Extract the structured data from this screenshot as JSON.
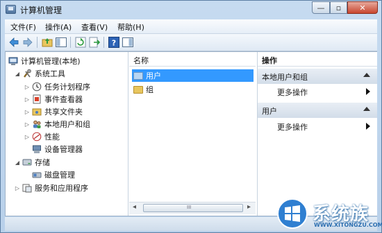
{
  "window": {
    "title": "计算机管理",
    "min_glyph": "—",
    "max_glyph": "▫",
    "close_glyph": "✕"
  },
  "menu": [
    "文件(F)",
    "操作(A)",
    "查看(V)",
    "帮助(H)"
  ],
  "toolbar_icons": [
    "back-arrow-icon",
    "forward-arrow-icon",
    "up-folder-icon",
    "show-hide-tree-icon",
    "refresh-icon",
    "export-list-icon",
    "help-icon",
    "show-hide-action-pane-icon"
  ],
  "tree": {
    "root": "计算机管理(本地)",
    "items": [
      {
        "label": "系统工具",
        "icon": "tools-icon",
        "expander": "◢"
      },
      {
        "label": "任务计划程序",
        "icon": "clock-icon",
        "expander": "▷"
      },
      {
        "label": "事件查看器",
        "icon": "event-viewer-icon",
        "expander": "▷"
      },
      {
        "label": "共享文件夹",
        "icon": "shared-folder-icon",
        "expander": "▷"
      },
      {
        "label": "本地用户和组",
        "icon": "users-icon",
        "expander": "▷"
      },
      {
        "label": "性能",
        "icon": "performance-icon",
        "expander": "▷"
      },
      {
        "label": "设备管理器",
        "icon": "device-manager-icon",
        "expander": ""
      },
      {
        "label": "存储",
        "icon": "storage-icon",
        "expander": "◢"
      },
      {
        "label": "磁盘管理",
        "icon": "disk-icon",
        "expander": ""
      },
      {
        "label": "服务和应用程序",
        "icon": "services-icon",
        "expander": "▷"
      }
    ]
  },
  "list": {
    "header": "名称",
    "rows": [
      {
        "label": "用户",
        "selected": true
      },
      {
        "label": "组",
        "selected": false
      }
    ],
    "scroll_glyph_left": "◂",
    "scroll_glyph_right": "▸",
    "scroll_grip": "III"
  },
  "actions": {
    "title": "操作",
    "groups": [
      {
        "label": "本地用户和组",
        "more": "更多操作"
      },
      {
        "label": "用户",
        "more": "更多操作"
      }
    ]
  },
  "watermark": {
    "text": "系统族",
    "url": "WWW.XITONGZU.COM"
  }
}
